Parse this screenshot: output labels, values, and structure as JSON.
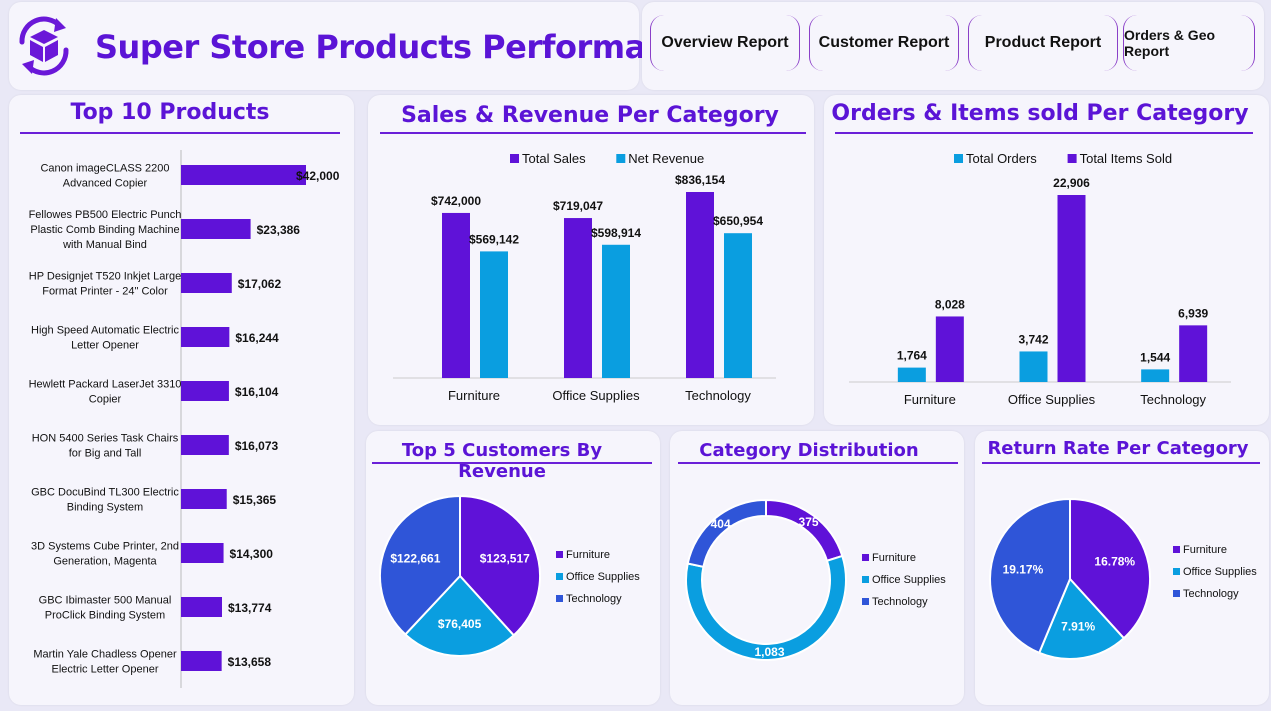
{
  "header": {
    "title": "Super Store Products Performance",
    "logo_icon": "box-refresh-icon"
  },
  "nav": [
    {
      "label": "Overview Report"
    },
    {
      "label": "Customer Report"
    },
    {
      "label": "Product Report"
    },
    {
      "label": "Orders & Geo Report"
    }
  ],
  "colors": {
    "purple": "#5f12d8",
    "cyan": "#0a9ee0",
    "blue": "#2f55d8",
    "title": "#5b14d6"
  },
  "top_products": {
    "title": "Top 10 Products",
    "chart_data": {
      "type": "bar",
      "orientation": "horizontal",
      "categories": [
        [
          "Canon imageCLASS 2200",
          "Advanced Copier"
        ],
        [
          "Fellowes PB500 Electric Punch",
          "Plastic Comb Binding Machine",
          "with Manual Bind"
        ],
        [
          "HP Designjet T520 Inkjet Large",
          "Format Printer - 24\" Color"
        ],
        [
          "High Speed Automatic Electric",
          "Letter Opener"
        ],
        [
          "Hewlett Packard LaserJet 3310",
          "Copier"
        ],
        [
          "HON 5400 Series Task Chairs",
          "for Big and Tall"
        ],
        [
          "GBC DocuBind TL300 Electric",
          "Binding System"
        ],
        [
          "3D Systems Cube Printer, 2nd",
          "Generation, Magenta"
        ],
        [
          "GBC Ibimaster 500 Manual",
          "ProClick Binding System"
        ],
        [
          "Martin Yale Chadless Opener",
          "Electric Letter Opener"
        ]
      ],
      "values": [
        42000,
        23386,
        17062,
        16244,
        16104,
        16073,
        15365,
        14300,
        13774,
        13658
      ],
      "labels": [
        "$42,000",
        "$23,386",
        "$17,062",
        "$16,244",
        "$16,104",
        "$16,073",
        "$15,365",
        "$14,300",
        "$13,774",
        "$13,658"
      ]
    }
  },
  "sales_revenue": {
    "title": "Sales & Revenue Per Category",
    "chart_data": {
      "type": "bar",
      "categories": [
        "Furniture",
        "Office Supplies",
        "Technology"
      ],
      "series": [
        {
          "name": "Total Sales",
          "values": [
            742000,
            719047,
            836154
          ],
          "labels": [
            "$742,000",
            "$719,047",
            "$836,154"
          ]
        },
        {
          "name": "Net Revenue",
          "values": [
            569142,
            598914,
            650954
          ],
          "labels": [
            "$569,142",
            "$598,914",
            "$650,954"
          ]
        }
      ]
    }
  },
  "orders_items": {
    "title": "Orders & Items sold Per Category",
    "chart_data": {
      "type": "bar",
      "categories": [
        "Furniture",
        "Office Supplies",
        "Technology"
      ],
      "series": [
        {
          "name": "Total Orders",
          "values": [
            1764,
            3742,
            1544
          ],
          "labels": [
            "1,764",
            "3,742",
            "1,544"
          ]
        },
        {
          "name": "Total Items Sold",
          "values": [
            8028,
            22906,
            6939
          ],
          "labels": [
            "8,028",
            "22,906",
            "6,939"
          ]
        }
      ]
    }
  },
  "top_customers": {
    "title": "Top 5 Customers By Revenue",
    "chart_data": {
      "type": "pie",
      "categories": [
        "Furniture",
        "Office Supplies",
        "Technology"
      ],
      "values": [
        123517,
        76405,
        122661
      ],
      "labels": [
        "$123,517",
        "$76,405",
        "$122,661"
      ]
    }
  },
  "category_distribution": {
    "title": "Category Distribution",
    "chart_data": {
      "type": "pie",
      "variant": "donut",
      "categories": [
        "Furniture",
        "Office Supplies",
        "Technology"
      ],
      "values": [
        375,
        1083,
        404
      ],
      "labels": [
        "375",
        "1,083",
        "404"
      ]
    }
  },
  "return_rate": {
    "title": "Return Rate Per Category",
    "chart_data": {
      "type": "pie",
      "categories": [
        "Furniture",
        "Office Supplies",
        "Technology"
      ],
      "values": [
        16.78,
        7.91,
        19.17
      ],
      "labels": [
        "16.78%",
        "7.91%",
        "19.17%"
      ],
      "legend_order": [
        "Furniture",
        "Office Supplies",
        "Technology"
      ]
    }
  }
}
